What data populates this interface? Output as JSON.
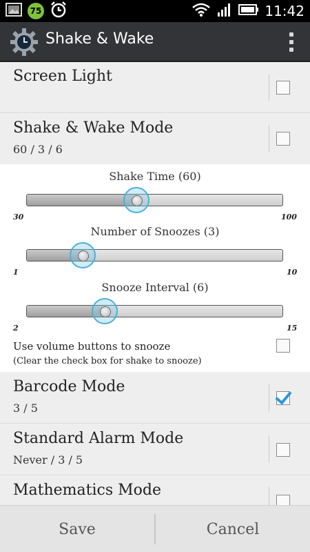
{
  "status_bar": {
    "battery_badge": "75",
    "time": "11:42"
  },
  "action_bar": {
    "title": "Shake & Wake"
  },
  "rows": {
    "screen_light": {
      "title": "Screen Light",
      "checked": false
    },
    "shake_wake_mode": {
      "title": "Shake & Wake Mode",
      "subtitle": "60 / 3 / 6",
      "checked": false
    },
    "barcode_mode": {
      "title": "Barcode Mode",
      "subtitle": "3 / 5",
      "checked": true
    },
    "standard_alarm_mode": {
      "title": "Standard Alarm Mode",
      "subtitle": "Never / 3 / 5",
      "checked": false
    },
    "mathematics_mode": {
      "title": "Mathematics Mode",
      "checked": false
    }
  },
  "sliders": [
    {
      "label": "Shake Time (60)",
      "min": "30",
      "max": "100",
      "value": 60
    },
    {
      "label": "Number of Snoozes (3)",
      "min": "1",
      "max": "10",
      "value": 3
    },
    {
      "label": "Snooze Interval (6)",
      "min": "2",
      "max": "15",
      "value": 6
    }
  ],
  "volume_option": {
    "label": "Use volume buttons to snooze",
    "sublabel": "(Clear the check box for shake to snooze)",
    "checked": false
  },
  "buttons": {
    "save": "Save",
    "cancel": "Cancel"
  },
  "colors": {
    "accent": "#2a9ad8",
    "thumb_ring": "#4cb0d8",
    "action_bar": "#333437",
    "battery_badge": "#7ec33a"
  }
}
